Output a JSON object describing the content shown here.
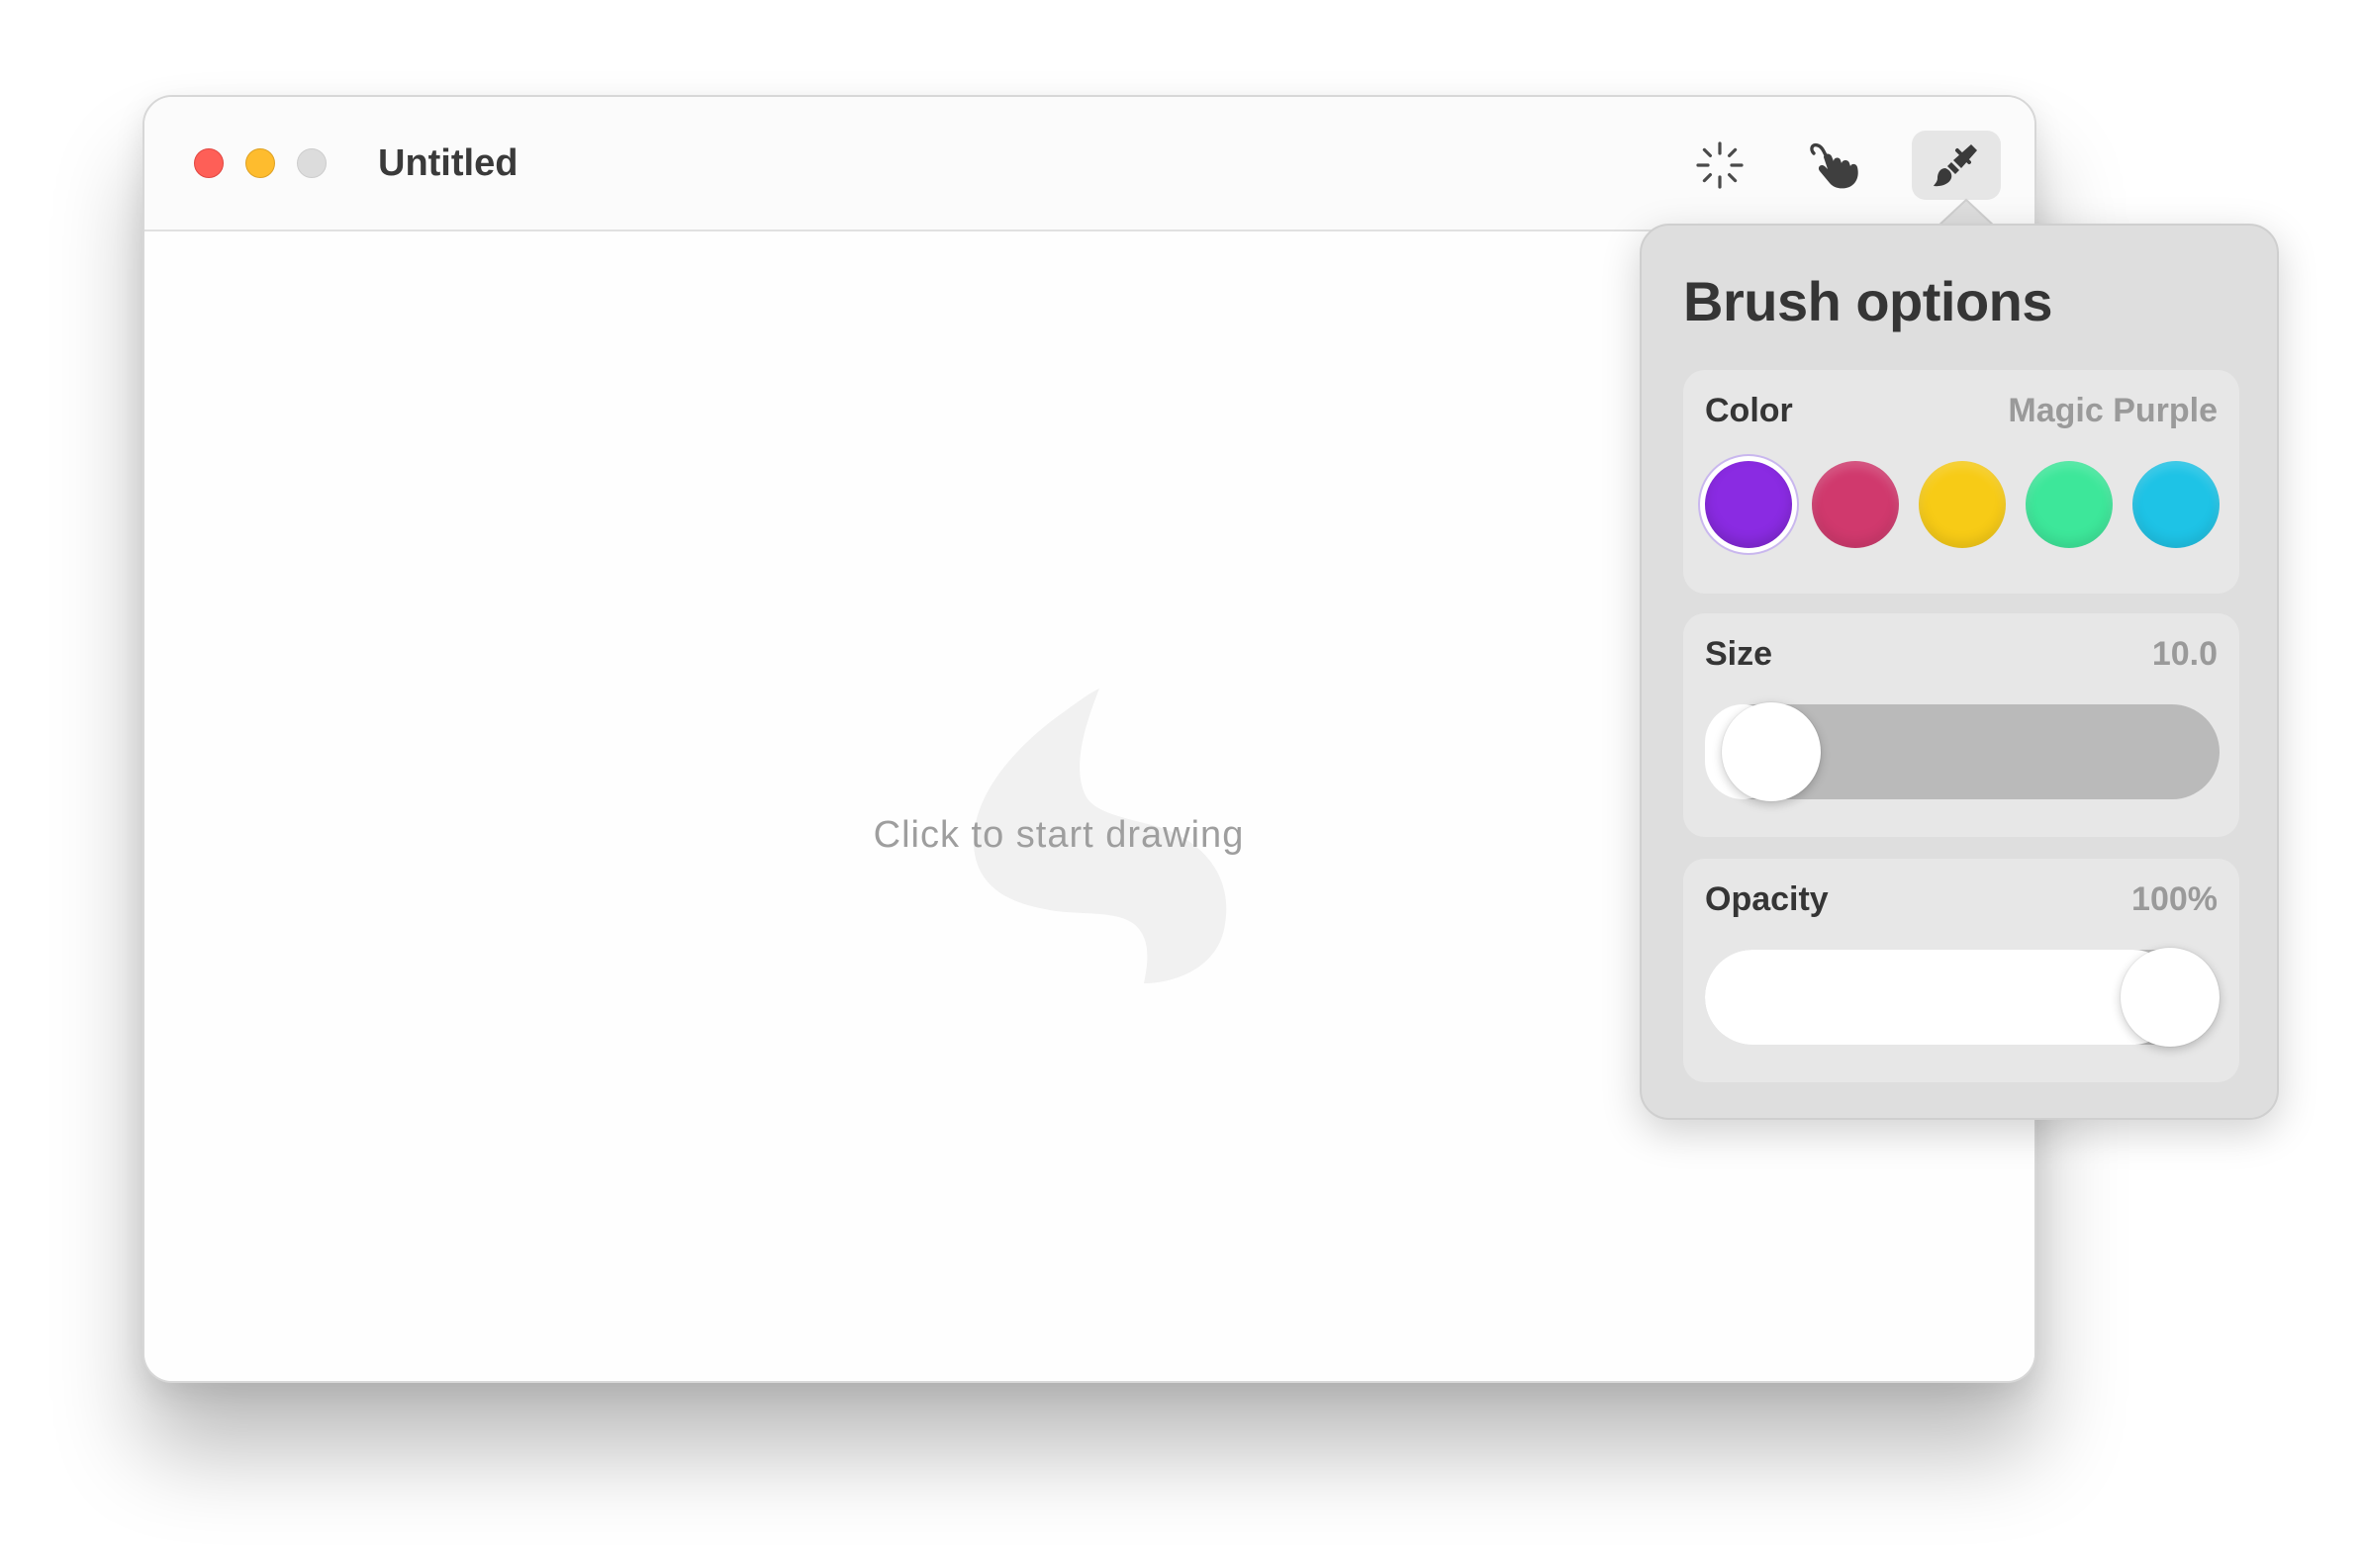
{
  "window": {
    "title": "Untitled",
    "traffic_lights": [
      "close",
      "minimize",
      "zoom"
    ]
  },
  "toolbar": {
    "buttons": [
      {
        "icon": "sparkle-icon",
        "active": false
      },
      {
        "icon": "hand-pointer-icon",
        "active": false
      },
      {
        "icon": "paintbrush-icon",
        "active": true
      }
    ]
  },
  "canvas": {
    "placeholder_icon": "scribble-icon",
    "hint": "Click to start drawing"
  },
  "brush_options": {
    "title": "Brush options",
    "color": {
      "label": "Color",
      "selected_name": "Magic Purple",
      "swatches": [
        {
          "hex": "#8a2be2",
          "selected": true
        },
        {
          "hex": "#d0396d",
          "selected": false
        },
        {
          "hex": "#f7cb16",
          "selected": false
        },
        {
          "hex": "#3de79a",
          "selected": false
        },
        {
          "hex": "#1ec3e6",
          "selected": false
        }
      ]
    },
    "size": {
      "label": "Size",
      "value_text": "10.0",
      "fraction": 0.04
    },
    "opacity": {
      "label": "Opacity",
      "value_text": "100%",
      "fraction": 1.0
    }
  }
}
